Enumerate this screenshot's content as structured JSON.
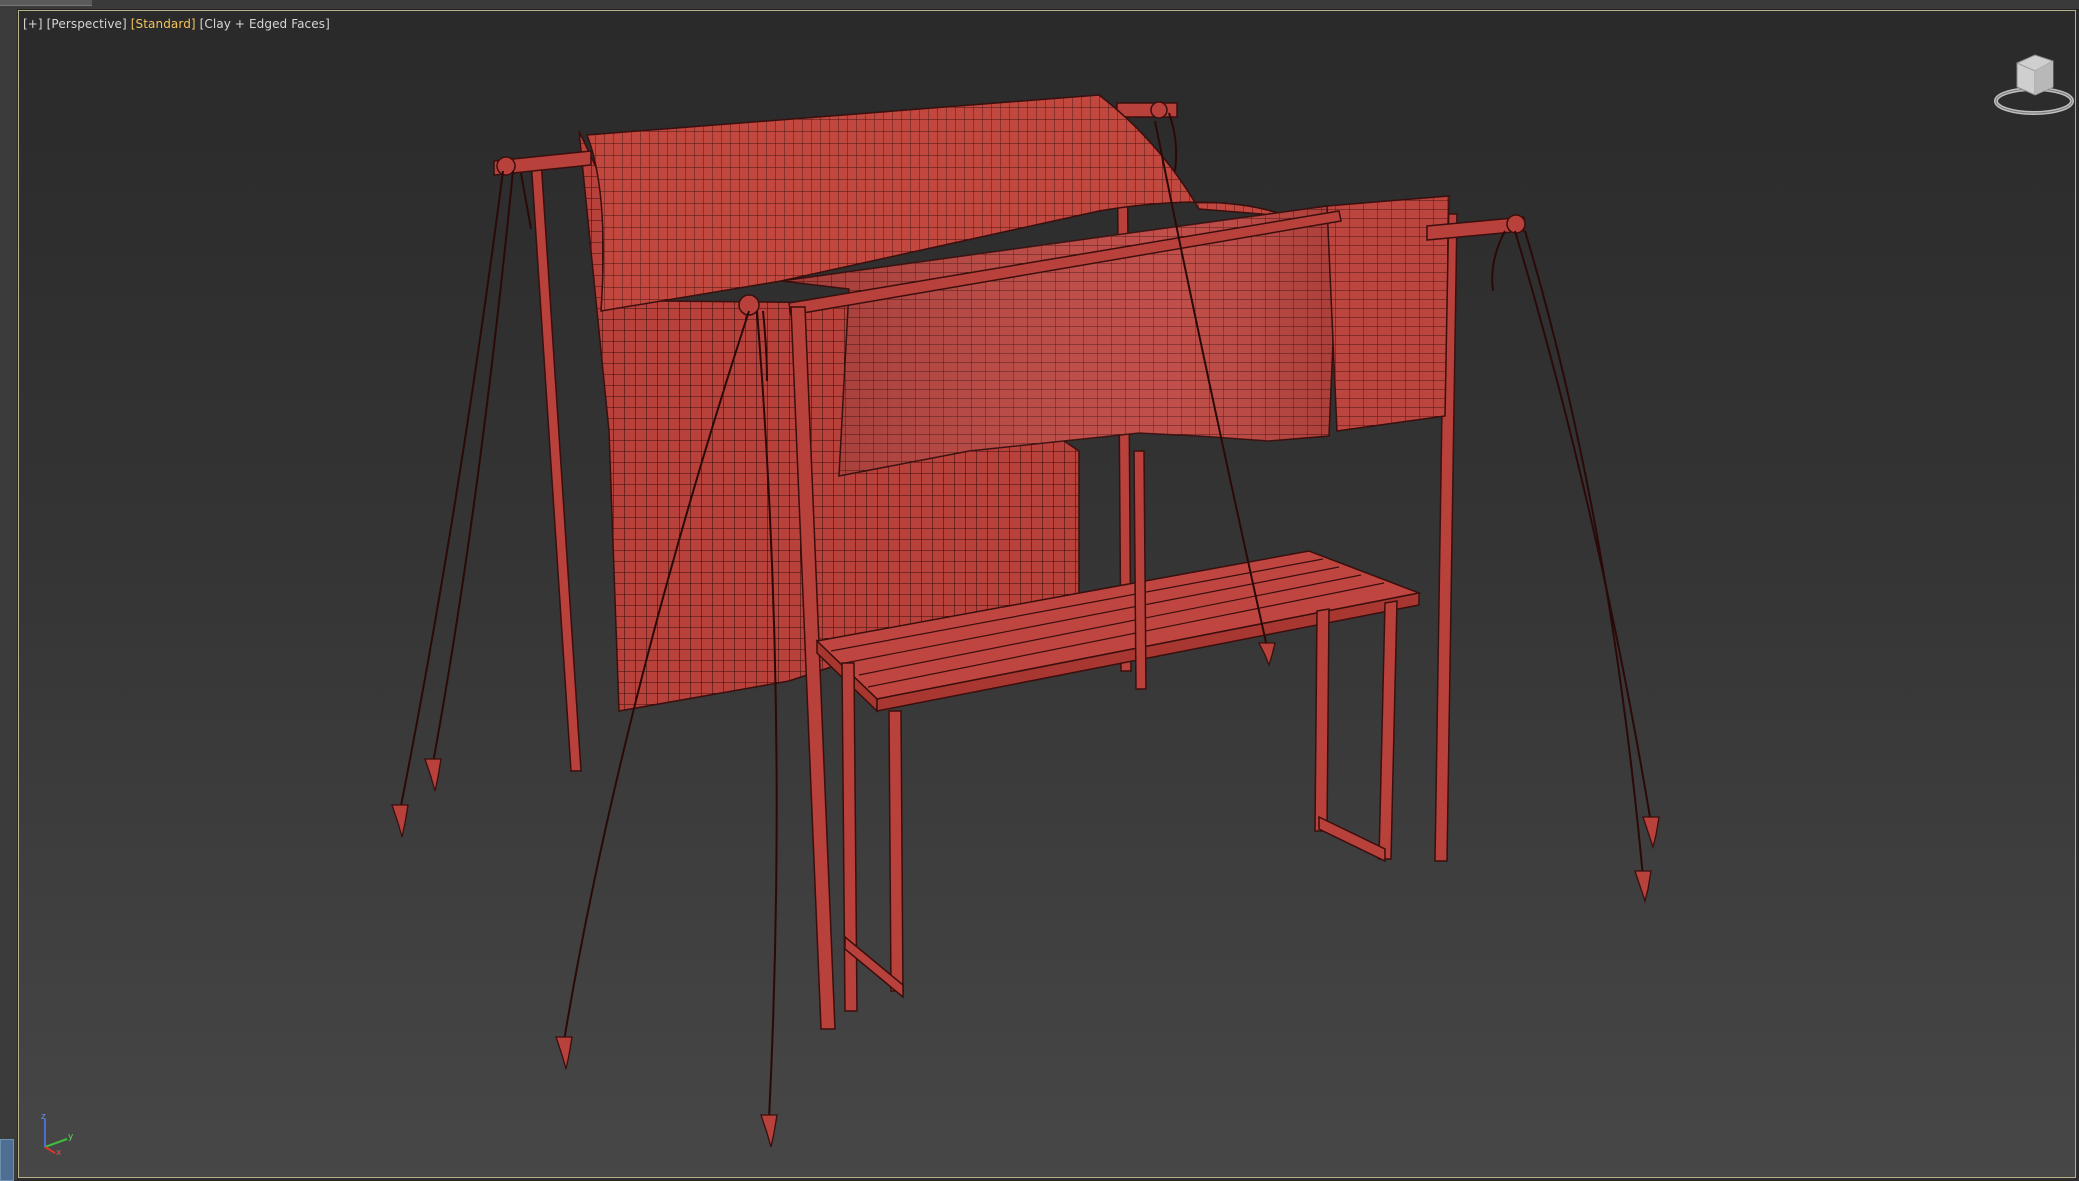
{
  "viewport": {
    "menu_plus": "[+]",
    "view_name": "[Perspective]",
    "shading_mode": "[Standard]",
    "display_style": "[Clay + Edged Faces]",
    "active_label_color": "#f4c25c",
    "border_color": "#b7b28a"
  },
  "scene": {
    "object_color": "#b8413c",
    "edge_color": "#3a0f0d",
    "objects": [
      "canopy-cloth",
      "back-cloth",
      "wooden-bench",
      "support-poles",
      "guy-ropes",
      "ground-stakes"
    ]
  },
  "navigation": {
    "viewcube_icon": "viewcube-icon",
    "axis_icon": "axis-tripod-icon",
    "axis_labels": [
      "z",
      "y",
      "x"
    ]
  }
}
